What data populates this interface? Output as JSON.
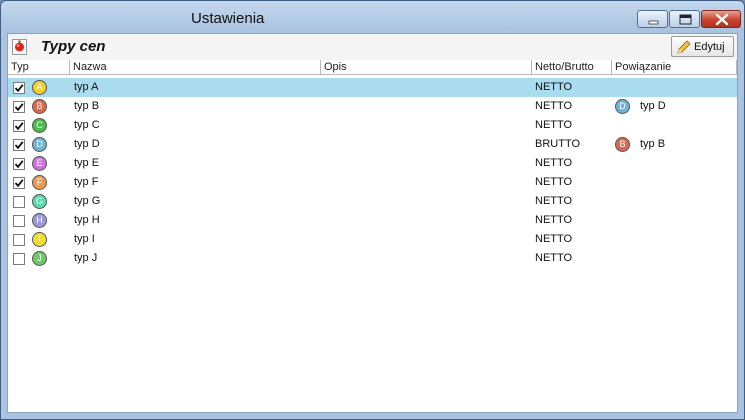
{
  "window": {
    "title": "Ustawienia"
  },
  "toolbar": {
    "title": "Typy cen",
    "edit_label": "Edytuj"
  },
  "table": {
    "headers": {
      "typ": "Typ",
      "nazwa": "Nazwa",
      "opis": "Opis",
      "netto_brutto": "Netto/Brutto",
      "powiazanie": "Powiązanie"
    },
    "rows": [
      {
        "letter": "A",
        "color": "#f0d030",
        "checked": true,
        "name": "typ A",
        "opis": "",
        "netto_brutto": "NETTO",
        "link_letter": "",
        "link_color": "",
        "link_name": "",
        "selected": true
      },
      {
        "letter": "B",
        "color": "#d96a4e",
        "checked": true,
        "name": "typ B",
        "opis": "",
        "netto_brutto": "NETTO",
        "link_letter": "D",
        "link_color": "#6fb3d8",
        "link_name": "typ D",
        "selected": false
      },
      {
        "letter": "C",
        "color": "#4bbb4a",
        "checked": true,
        "name": "typ C",
        "opis": "",
        "netto_brutto": "NETTO",
        "link_letter": "",
        "link_color": "",
        "link_name": "",
        "selected": false
      },
      {
        "letter": "D",
        "color": "#6fb3d8",
        "checked": true,
        "name": "typ D",
        "opis": "",
        "netto_brutto": "BRUTTO",
        "link_letter": "B",
        "link_color": "#d96a4e",
        "link_name": "typ B",
        "selected": false
      },
      {
        "letter": "E",
        "color": "#c876d8",
        "checked": true,
        "name": "typ E",
        "opis": "",
        "netto_brutto": "NETTO",
        "link_letter": "",
        "link_color": "",
        "link_name": "",
        "selected": false
      },
      {
        "letter": "F",
        "color": "#eb9a52",
        "checked": true,
        "name": "typ F",
        "opis": "",
        "netto_brutto": "NETTO",
        "link_letter": "",
        "link_color": "",
        "link_name": "",
        "selected": false
      },
      {
        "letter": "G",
        "color": "#5fd7b0",
        "checked": false,
        "name": "typ G",
        "opis": "",
        "netto_brutto": "NETTO",
        "link_letter": "",
        "link_color": "",
        "link_name": "",
        "selected": false
      },
      {
        "letter": "H",
        "color": "#9a9ad8",
        "checked": false,
        "name": "typ H",
        "opis": "",
        "netto_brutto": "NETTO",
        "link_letter": "",
        "link_color": "",
        "link_name": "",
        "selected": false
      },
      {
        "letter": "I",
        "color": "#eedd3a",
        "checked": false,
        "name": "typ I",
        "opis": "",
        "netto_brutto": "NETTO",
        "link_letter": "",
        "link_color": "",
        "link_name": "",
        "selected": false
      },
      {
        "letter": "J",
        "color": "#6fc86a",
        "checked": false,
        "name": "typ J",
        "opis": "",
        "netto_brutto": "NETTO",
        "link_letter": "",
        "link_color": "",
        "link_name": "",
        "selected": false
      }
    ]
  }
}
